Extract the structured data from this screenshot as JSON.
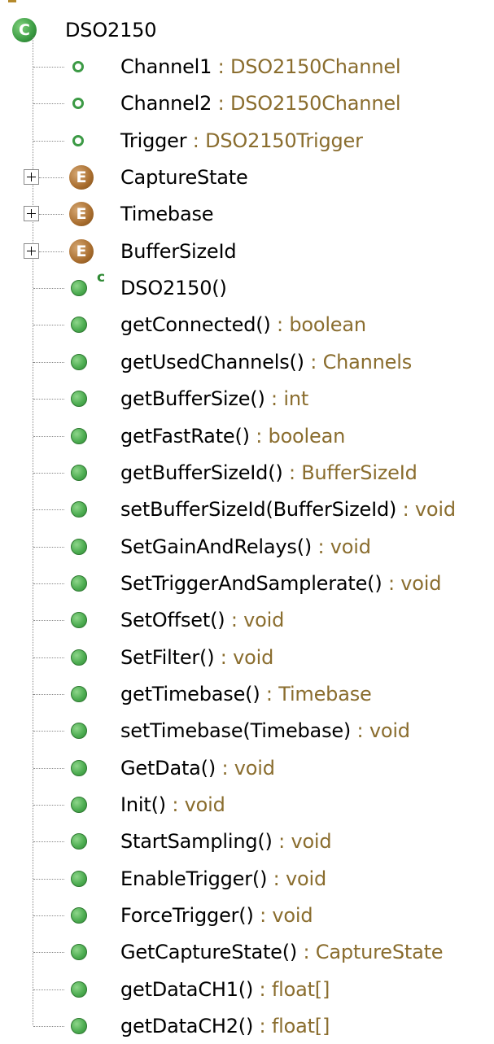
{
  "tree": {
    "root": {
      "label": "DSO2150",
      "icon": "class-icon"
    },
    "items": [
      {
        "kind": "field",
        "name": "Channel1",
        "type": ": DSO2150Channel"
      },
      {
        "kind": "field",
        "name": "Channel2",
        "type": ": DSO2150Channel"
      },
      {
        "kind": "field",
        "name": "Trigger",
        "type": ": DSO2150Trigger"
      },
      {
        "kind": "enum",
        "name": "CaptureState",
        "type": "",
        "expandable": true,
        "icon_letter": "E"
      },
      {
        "kind": "enum",
        "name": "Timebase",
        "type": "",
        "expandable": true,
        "icon_letter": "E"
      },
      {
        "kind": "enum",
        "name": "BufferSizeId",
        "type": "",
        "expandable": true,
        "icon_letter": "E"
      },
      {
        "kind": "constructor",
        "name": "DSO2150()",
        "type": "",
        "badge": "c"
      },
      {
        "kind": "method",
        "name": "getConnected()",
        "type": ": boolean"
      },
      {
        "kind": "method",
        "name": "getUsedChannels()",
        "type": ": Channels"
      },
      {
        "kind": "method",
        "name": "getBufferSize()",
        "type": ": int"
      },
      {
        "kind": "method",
        "name": "getFastRate()",
        "type": ": boolean"
      },
      {
        "kind": "method",
        "name": "getBufferSizeId()",
        "type": ": BufferSizeId"
      },
      {
        "kind": "method",
        "name": "setBufferSizeId(BufferSizeId)",
        "type": ": void"
      },
      {
        "kind": "method",
        "name": "SetGainAndRelays()",
        "type": ": void"
      },
      {
        "kind": "method",
        "name": "SetTriggerAndSamplerate()",
        "type": ": void"
      },
      {
        "kind": "method",
        "name": "SetOffset()",
        "type": ": void"
      },
      {
        "kind": "method",
        "name": "SetFilter()",
        "type": ": void"
      },
      {
        "kind": "method",
        "name": "getTimebase()",
        "type": ": Timebase"
      },
      {
        "kind": "method",
        "name": "setTimebase(Timebase)",
        "type": ": void"
      },
      {
        "kind": "method",
        "name": "GetData()",
        "type": ": void"
      },
      {
        "kind": "method",
        "name": "Init()",
        "type": ": void"
      },
      {
        "kind": "method",
        "name": "StartSampling()",
        "type": ": void"
      },
      {
        "kind": "method",
        "name": "EnableTrigger()",
        "type": ": void"
      },
      {
        "kind": "method",
        "name": "ForceTrigger()",
        "type": ": void"
      },
      {
        "kind": "method",
        "name": "GetCaptureState()",
        "type": ": CaptureState"
      },
      {
        "kind": "method",
        "name": "getDataCH1()",
        "type": ": float[]"
      },
      {
        "kind": "method",
        "name": "getDataCH2()",
        "type": ": float[]"
      }
    ]
  },
  "colors": {
    "type_text": "#8a6d2e",
    "method_icon": "#4fae53",
    "enum_icon": "#a86d2e",
    "class_icon": "#3a9b42"
  }
}
